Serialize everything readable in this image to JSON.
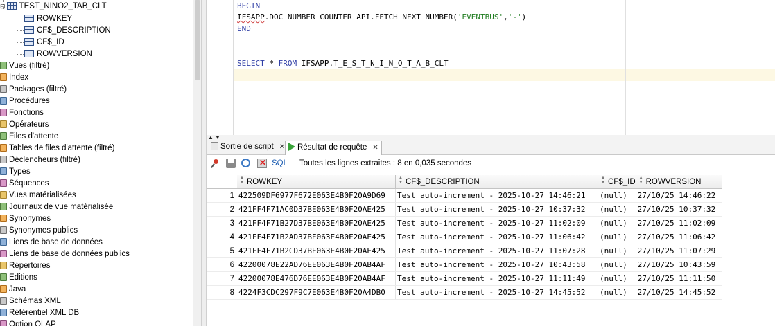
{
  "navigator": {
    "table_name": "TEST_NINO2_TAB_CLT",
    "columns": [
      "ROWKEY",
      "CF$_DESCRIPTION",
      "CF$_ID",
      "ROWVERSION"
    ],
    "folders": [
      {
        "label": "Vues (filtré)",
        "icon": "views-icon"
      },
      {
        "label": "Index",
        "icon": "index-icon"
      },
      {
        "label": "Packages (filtré)",
        "icon": "package-icon"
      },
      {
        "label": "Procédures",
        "icon": "procedure-icon"
      },
      {
        "label": "Fonctions",
        "icon": "function-icon"
      },
      {
        "label": "Opérateurs",
        "icon": "operator-icon"
      },
      {
        "label": "Files d'attente",
        "icon": "queue-icon"
      },
      {
        "label": "Tables de files d'attente (filtré)",
        "icon": "queue-table-icon"
      },
      {
        "label": "Déclencheurs (filtré)",
        "icon": "trigger-icon"
      },
      {
        "label": "Types",
        "icon": "type-icon"
      },
      {
        "label": "Séquences",
        "icon": "sequence-icon"
      },
      {
        "label": "Vues matérialisées",
        "icon": "mview-icon"
      },
      {
        "label": "Journaux de vue matérialisée",
        "icon": "mview-log-icon"
      },
      {
        "label": "Synonymes",
        "icon": "synonym-icon"
      },
      {
        "label": "Synonymes publics",
        "icon": "public-synonym-icon"
      },
      {
        "label": "Liens de base de données",
        "icon": "dblink-icon"
      },
      {
        "label": "Liens de base de données publics",
        "icon": "public-dblink-icon"
      },
      {
        "label": "Répertoires",
        "icon": "directory-icon"
      },
      {
        "label": "Editions",
        "icon": "edition-icon"
      },
      {
        "label": "Java",
        "icon": "java-icon"
      },
      {
        "label": "Schémas XML",
        "icon": "xml-schema-icon"
      },
      {
        "label": "Référentiel XML DB",
        "icon": "xml-db-icon"
      },
      {
        "label": "Option OLAP",
        "icon": "olap-icon"
      }
    ]
  },
  "editor": {
    "line1": "BEGIN",
    "line2_pkg": "IFSAPP",
    "line2_rest": ".DOC_NUMBER_COUNTER_API.FETCH_NEXT_NUMBER(",
    "line2_arg1": "'EVENTBUS'",
    "line2_comma": ",",
    "line2_arg2": "'-'",
    "line2_end": ")",
    "line3": "END",
    "sql_kw1": "SELECT",
    "sql_star": " * ",
    "sql_kw2": "FROM",
    "sql_rest": " IFSAPP.T_E_S_T_N_I_N_O_T_A_B_CLT"
  },
  "tabs": [
    {
      "label": "Sortie de script",
      "close": "✕"
    },
    {
      "label": "Résultat de requête",
      "close": "✕"
    }
  ],
  "toolbar": {
    "sql_label": "SQL",
    "status": "Toutes les lignes extraites : 8 en 0,035 secondes"
  },
  "grid": {
    "headers": [
      "ROWKEY",
      "CF$_DESCRIPTION",
      "CF$_ID",
      "ROWVERSION"
    ],
    "rows": [
      [
        "1",
        "422509DF6977F672E063E4B0F20A9D69",
        "Test auto-increment - 2025-10-27 14:46:21",
        "(null)",
        "27/10/25 14:46:22"
      ],
      [
        "2",
        "421FF4F71AC0D37BE063E4B0F20AE425",
        "Test auto-increment - 2025-10-27 10:37:32",
        "(null)",
        "27/10/25 10:37:32"
      ],
      [
        "3",
        "421FF4F71B27D37BE063E4B0F20AE425",
        "Test auto-increment - 2025-10-27 11:02:09",
        "(null)",
        "27/10/25 11:02:09"
      ],
      [
        "4",
        "421FF4F71B2AD37BE063E4B0F20AE425",
        "Test auto-increment - 2025-10-27 11:06:42",
        "(null)",
        "27/10/25 11:06:42"
      ],
      [
        "5",
        "421FF4F71B2CD37BE063E4B0F20AE425",
        "Test auto-increment - 2025-10-27 11:07:28",
        "(null)",
        "27/10/25 11:07:29"
      ],
      [
        "6",
        "42200078E22AD76EE063E4B0F20AB4AF",
        "Test auto-increment - 2025-10-27 10:43:58",
        "(null)",
        "27/10/25 10:43:59"
      ],
      [
        "7",
        "42200078E476D76EE063E4B0F20AB4AF",
        "Test auto-increment - 2025-10-27 11:11:49",
        "(null)",
        "27/10/25 11:11:50"
      ],
      [
        "8",
        "4224F3CDC297F9C7E063E4B0F20A4DB0",
        "Test auto-increment - 2025-10-27 14:45:52",
        "(null)",
        "27/10/25 14:45:52"
      ]
    ]
  }
}
